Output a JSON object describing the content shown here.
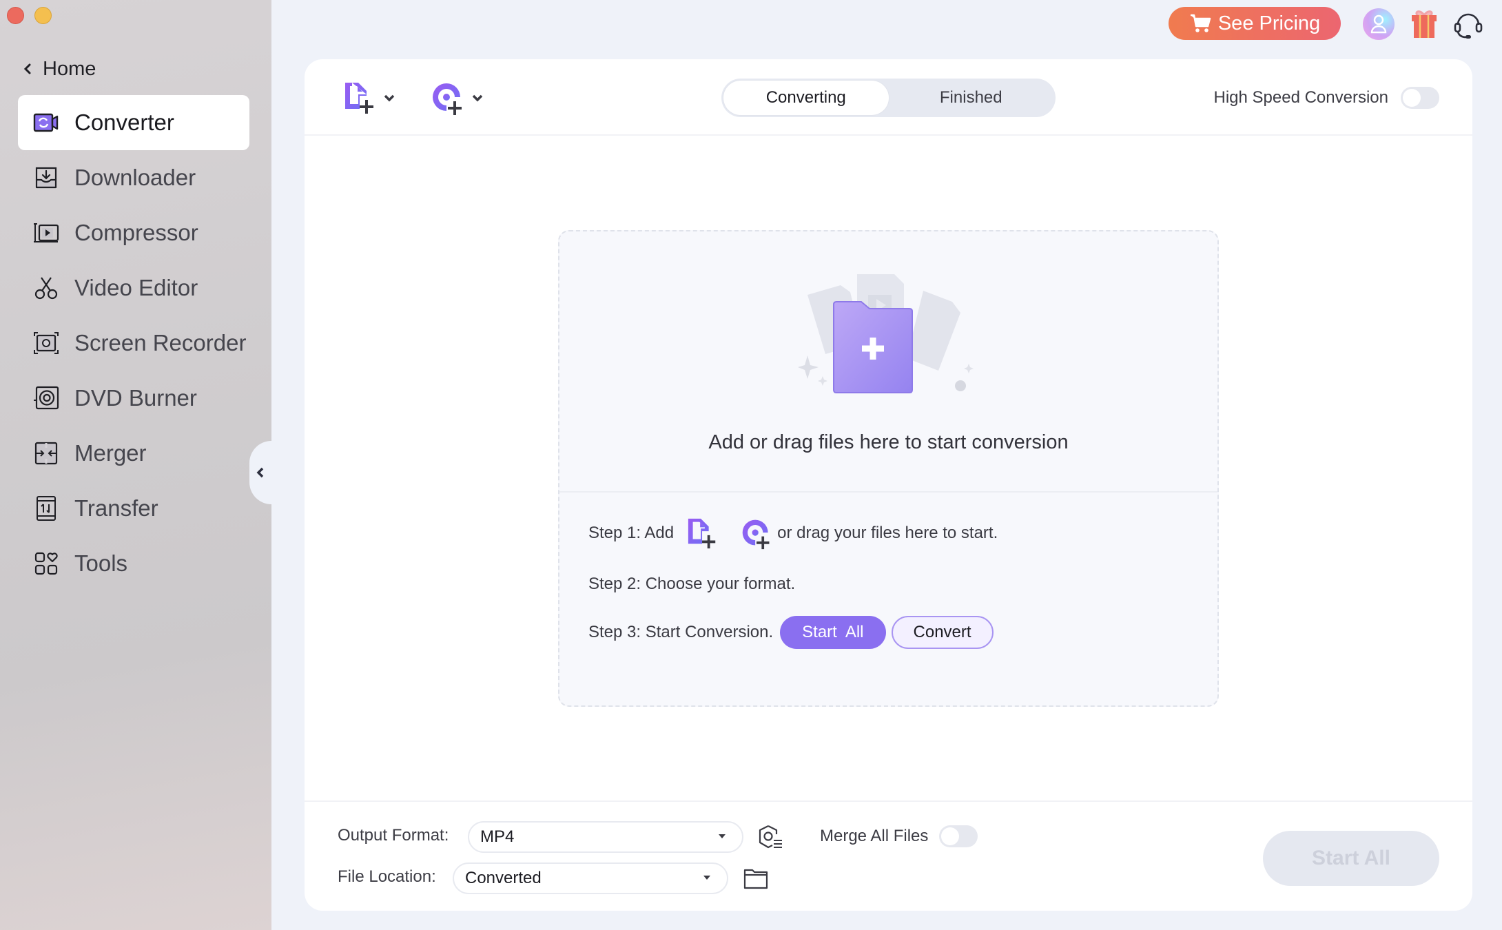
{
  "window": {
    "controls": [
      "close",
      "minimize"
    ]
  },
  "sidebar": {
    "home_label": "Home",
    "items": [
      {
        "label": "Converter",
        "icon": "converter-icon",
        "active": true
      },
      {
        "label": "Downloader",
        "icon": "downloader-icon",
        "active": false
      },
      {
        "label": "Compressor",
        "icon": "compressor-icon",
        "active": false
      },
      {
        "label": "Video Editor",
        "icon": "scissors-icon",
        "active": false
      },
      {
        "label": "Screen Recorder",
        "icon": "screen-recorder-icon",
        "active": false
      },
      {
        "label": "DVD Burner",
        "icon": "dvd-icon",
        "active": false
      },
      {
        "label": "Merger",
        "icon": "merger-icon",
        "active": false
      },
      {
        "label": "Transfer",
        "icon": "transfer-icon",
        "active": false
      },
      {
        "label": "Tools",
        "icon": "tools-icon",
        "active": false
      }
    ]
  },
  "header": {
    "pricing_label": "See Pricing",
    "pricing_icon": "cart-icon",
    "icons": [
      "avatar-icon",
      "gift-icon",
      "headset-icon"
    ],
    "accent_gradient": [
      "#f07b4f",
      "#ec6670"
    ]
  },
  "toolbar": {
    "add_file_icon": "add-file-icon",
    "add_disc_icon": "add-disc-icon",
    "tabs": [
      {
        "label": "Converting",
        "active": true
      },
      {
        "label": "Finished",
        "active": false
      }
    ],
    "high_speed_label": "High Speed Conversion",
    "high_speed_on": false
  },
  "dropzone": {
    "message": "Add or drag files here to start conversion",
    "step1_prefix": "Step 1: Add",
    "step1_suffix": "or drag your files here to start.",
    "step2": "Step 2: Choose your format.",
    "step3": "Step 3: Start Conversion.",
    "start_all_label": "Start  All",
    "convert_label": "Convert"
  },
  "bottom": {
    "output_format_label": "Output Format:",
    "output_format_value": "MP4",
    "file_location_label": "File Location:",
    "file_location_value": "Converted",
    "merge_label": "Merge All Files",
    "merge_on": false,
    "start_all_label": "Start All"
  },
  "colors": {
    "accent": "#8a6ff0",
    "background": "#eff2f9",
    "card": "#ffffff"
  }
}
